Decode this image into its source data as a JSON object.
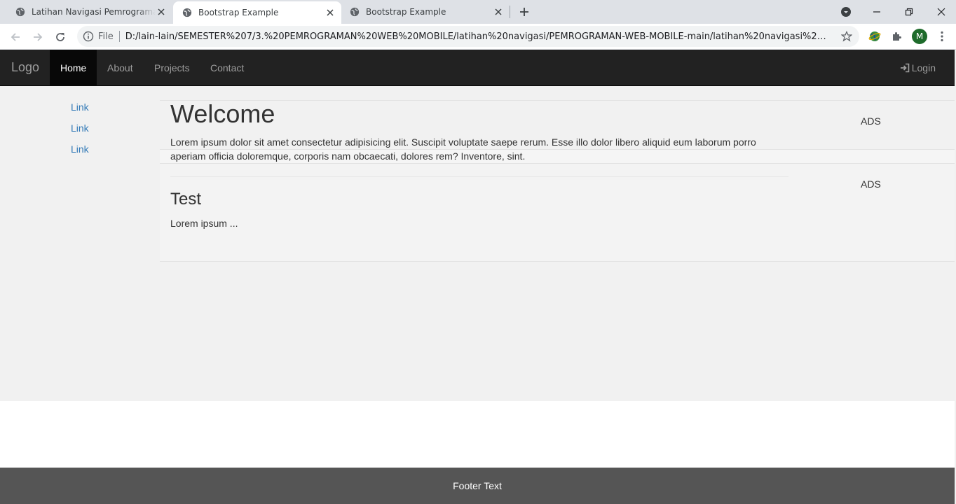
{
  "browser": {
    "tabs": [
      {
        "title": "Latihan Navigasi Pemrograman Web Mobile",
        "active": false
      },
      {
        "title": "Bootstrap Example",
        "active": true
      },
      {
        "title": "Bootstrap Example",
        "active": false
      }
    ],
    "address": {
      "scheme_label": "File",
      "url": "D:/lain-lain/SEMESTER%207/3.%20PEMROGRAMAN%20WEB%20MOBILE/latihan%20navigasi/PEMROGRAMAN-WEB-MOBILE-main/latihan%20navigasi%20Mask..."
    },
    "profile_initial": "M"
  },
  "navbar": {
    "brand": "Logo",
    "items": [
      {
        "label": "Home",
        "active": true
      },
      {
        "label": "About",
        "active": false
      },
      {
        "label": "Projects",
        "active": false
      },
      {
        "label": "Contact",
        "active": false
      }
    ],
    "login_label": "Login"
  },
  "sidenav": {
    "links": [
      "Link",
      "Link",
      "Link"
    ]
  },
  "main": {
    "heading": "Welcome",
    "intro": "Lorem ipsum dolor sit amet consectetur adipisicing elit. Suscipit voluptate saepe rerum. Esse illo dolor libero aliquid eum laborum porro aperiam officia doloremque, corporis nam obcaecati, dolores rem? Inventore, sint.",
    "section_title": "Test",
    "section_text": "Lorem ipsum ..."
  },
  "ads": [
    "ADS",
    "ADS"
  ],
  "footer": {
    "text": "Footer Text"
  },
  "colors": {
    "navbar_bg": "#222222",
    "link": "#337ab7",
    "footer_bg": "#555555",
    "content_bg": "#f1f1f1"
  }
}
